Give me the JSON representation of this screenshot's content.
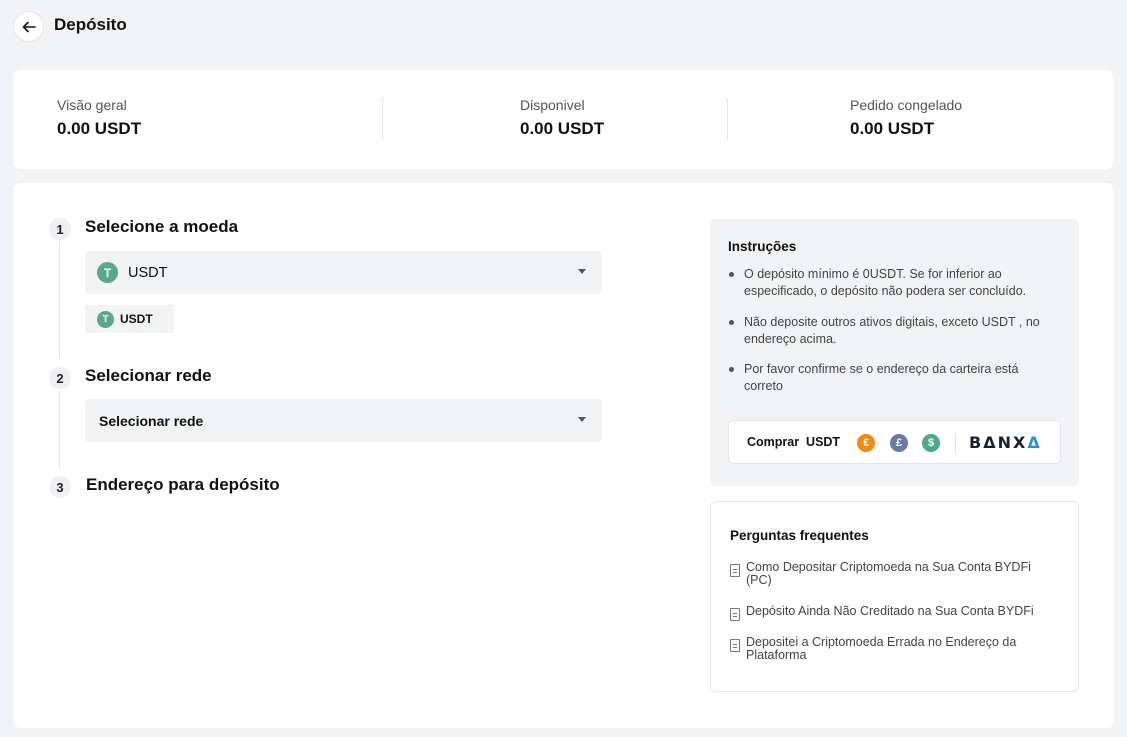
{
  "header": {
    "title": "Depósito"
  },
  "summary": {
    "overview": {
      "label": "Visão geral",
      "value": "0.00 USDT"
    },
    "available": {
      "label": "Disponivel",
      "value": "0.00 USDT"
    },
    "frozen": {
      "label": "Pedido congelado",
      "value": "0.00 USDT"
    }
  },
  "steps": [
    {
      "num": "1",
      "title": "Selecione a moeda"
    },
    {
      "num": "2",
      "title": "Selecionar rede"
    },
    {
      "num": "3",
      "title": "Endereço para depósito"
    }
  ],
  "coin_select": {
    "value": "USDT",
    "icon": "tether-icon",
    "chip": "USDT"
  },
  "network_select": {
    "placeholder": "Selecionar rede"
  },
  "instructions": {
    "title": "Instruções",
    "items": [
      "O depósito mínimo é 0USDT. Se for inferior ao especificado, o depósito não podera ser concluído.",
      "Não deposite outros ativos digitais, exceto USDT , no endereço acima.",
      "Por favor confirme se o endereço da carteira está correto"
    ],
    "buy": {
      "label": "Comprar  USDT",
      "currencies": [
        {
          "symbol": "€",
          "color": "#f08a12"
        },
        {
          "symbol": "£",
          "color": "#6b7aa1"
        },
        {
          "symbol": "$",
          "color": "#4fa88a"
        }
      ],
      "provider_prefix": "BΔNX",
      "provider_suffix": "Δ"
    }
  },
  "faq": {
    "title": "Perguntas frequentes",
    "items": [
      "Como Depositar Criptomoeda na Sua Conta BYDFi (PC)",
      "Depósito Ainda Não Creditado na Sua Conta BYDFi",
      "Depositei a Criptomoeda Errada no Endereço da Plataforma"
    ]
  }
}
